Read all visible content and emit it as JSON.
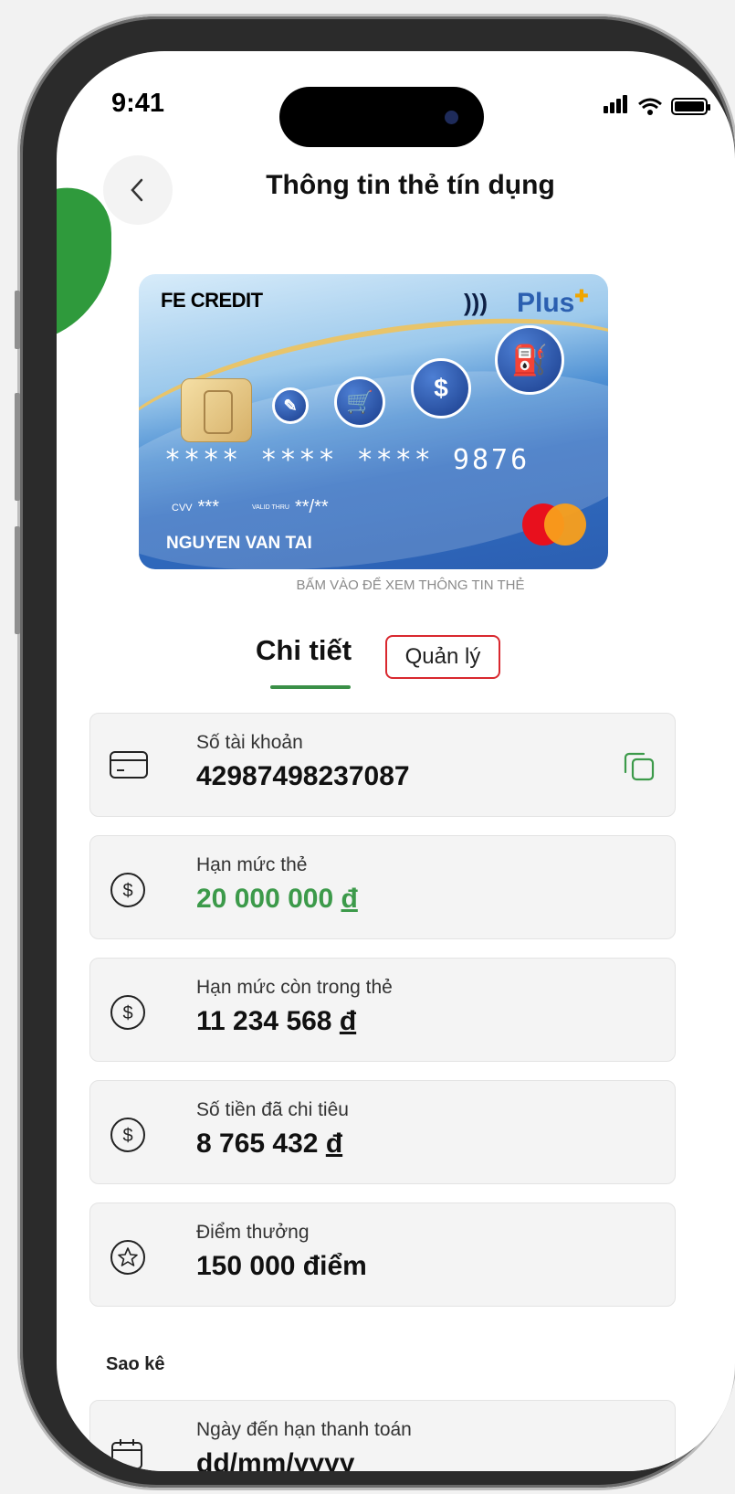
{
  "status_bar": {
    "time": "9:41"
  },
  "header": {
    "title": "Thông tin thẻ tín dụng"
  },
  "card": {
    "brand": "FE CREDIT",
    "nfc_symbol": ")))",
    "plus_label": "Plus",
    "number": "****  ****  ****  9876",
    "cvv_label": "CVV",
    "cvv_value": "***",
    "valid_label": "VALID THRU",
    "valid_value": "**/**",
    "holder_name": "NGUYEN VAN TAI",
    "hint": "BẤM VÀO ĐỂ XEM THÔNG TIN THẺ"
  },
  "tabs": [
    {
      "label": "Chi tiết",
      "active": true
    },
    {
      "label": "Quản lý",
      "active": false
    }
  ],
  "details": [
    {
      "label": "Số tài khoản",
      "value": "42987498237087",
      "icon": "credit-card-icon"
    },
    {
      "label": "Hạn mức thẻ",
      "value": "20 000 000",
      "currency": "đ",
      "icon": "dollar-circle-icon",
      "accent": "#3c9a4a"
    },
    {
      "label": "Hạn mức còn trong thẻ",
      "value": "11 234 568",
      "currency": "đ",
      "icon": "dollar-circle-icon"
    },
    {
      "label": "Số tiền đã chi tiêu",
      "value": "8 765 432",
      "currency": "đ",
      "icon": "dollar-circle-icon"
    },
    {
      "label": "Điểm thưởng",
      "value": "150 000 điểm",
      "icon": "star-circle-icon"
    }
  ],
  "statement": {
    "section_title": "Sao kê",
    "due_label": "Ngày đến hạn thanh toán",
    "due_value": "dd/mm/yyyy",
    "icon": "calendar-icon"
  },
  "colors": {
    "accent_green": "#3c9a4a",
    "highlight_red": "#d9282f"
  }
}
